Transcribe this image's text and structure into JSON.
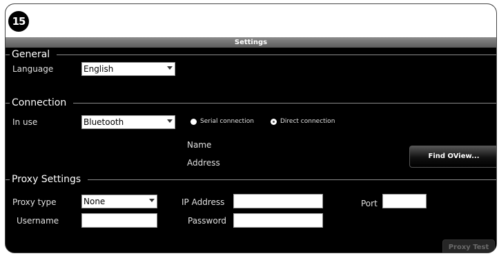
{
  "step_number": "15",
  "window": {
    "title": "Settings"
  },
  "general": {
    "section_title": "General",
    "language_label": "Language",
    "language_value": "English"
  },
  "connection": {
    "section_title": "Connection",
    "in_use_label": "In use",
    "in_use_value": "Bluetooth",
    "serial_label": "Serial connection",
    "direct_label": "Direct connection",
    "selected_mode": "Direct connection",
    "name_label": "Name",
    "address_label": "Address",
    "find_button": "Find OView..."
  },
  "proxy": {
    "section_title": "Proxy Settings",
    "type_label": "Proxy type",
    "type_value": "None",
    "ip_label": "IP Address",
    "ip_value": "",
    "port_label": "Port",
    "port_value": "",
    "username_label": "Username",
    "username_value": "",
    "password_label": "Password",
    "password_value": "",
    "test_button": "Proxy Test"
  }
}
